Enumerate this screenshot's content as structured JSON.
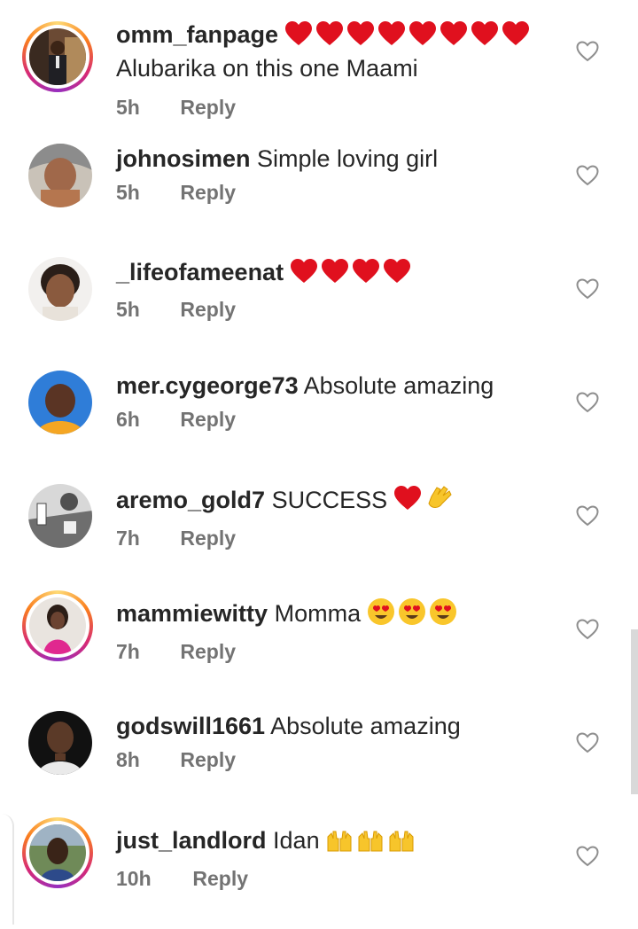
{
  "comments": [
    {
      "username": "omm_fanpage",
      "text": "",
      "extra_text": "Alubarika on this one Maami",
      "emojis": [
        "heart",
        "heart",
        "heart",
        "heart",
        "heart",
        "heart",
        "heart",
        "heart"
      ],
      "time": "5h",
      "reply": "Reply",
      "story_ring": true
    },
    {
      "username": "johnosimen",
      "text": "Simple loving girl",
      "emojis": [],
      "time": "5h",
      "reply": "Reply",
      "story_ring": false
    },
    {
      "username": "_lifeofameenat",
      "text": "",
      "emojis": [
        "heart",
        "heart",
        "heart",
        "heart"
      ],
      "time": "5h",
      "reply": "Reply",
      "story_ring": false
    },
    {
      "username": "mer.cygeorge73",
      "text": "Absolute amazing",
      "emojis": [],
      "time": "6h",
      "reply": "Reply",
      "story_ring": false
    },
    {
      "username": "aremo_gold7",
      "text": "SUCCESS",
      "emojis": [
        "heart",
        "clap"
      ],
      "time": "7h",
      "reply": "Reply",
      "story_ring": false
    },
    {
      "username": "mammiewitty",
      "text": "Momma",
      "emojis": [
        "heart-eyes",
        "heart-eyes",
        "heart-eyes"
      ],
      "time": "7h",
      "reply": "Reply",
      "story_ring": true
    },
    {
      "username": "godswill1661",
      "text": "Absolute amazing",
      "emojis": [],
      "time": "8h",
      "reply": "Reply",
      "story_ring": false
    },
    {
      "username": "just_landlord",
      "text": "Idan",
      "emojis": [
        "raising-hands",
        "raising-hands",
        "raising-hands"
      ],
      "time": "10h",
      "reply": "Reply",
      "story_ring": true
    }
  ],
  "colors": {
    "text": "#262626",
    "muted": "#737373",
    "heart": "#e0101e",
    "ring_start": "#feda75",
    "ring_end": "#d62976"
  },
  "icons": {
    "like": "heart-outline-icon"
  }
}
